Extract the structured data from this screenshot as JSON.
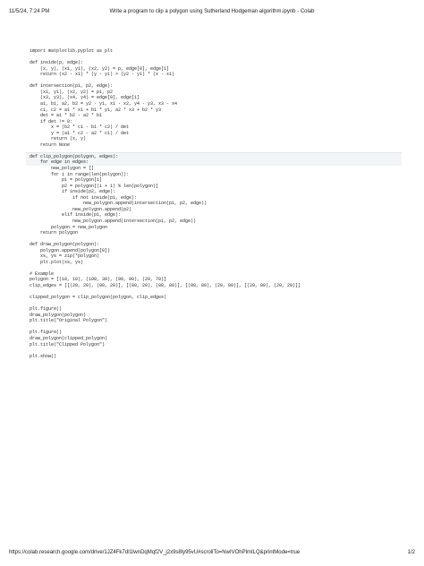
{
  "header": {
    "datetime": "11/5/24, 7:24 PM",
    "title": "Write a program to clip a polygon using Sutherland Hodgeman algorithm.ipynb - Colab"
  },
  "footer": {
    "url": "https://colab.research.google.com/drive/1JZ4Fk7dI1lwnDqMqf2V_j2x9s8ly95vU#scrollTo=NwIVOhPlmILQ&printMode=true",
    "page": "1/2"
  },
  "code": {
    "lines": [
      "import matplotlib.pyplot as plt",
      "",
      "def inside(p, edge):",
      "    (x, y), (x1, y1), (x2, y2) = p, edge[0], edge[1]",
      "    return (x2 - x1) * (y - y1) > (y2 - y1) * (x - x1)",
      "",
      "def intersection(p1, p2, edge):",
      "    (x1, y1), (x2, y2) = p1, p2",
      "    (x3, y3), (x4, y4) = edge[0], edge[1]",
      "    a1, b1, a2, b2 = y2 - y1, x1 - x2, y4 - y3, x3 - x4",
      "    c1, c2 = a1 * x1 + b1 * y1, a2 * x3 + b2 * y3",
      "    det = a1 * b2 - a2 * b1",
      "    if det != 0:",
      "        x = (b2 * c1 - b1 * c2) / det",
      "        y = (a1 * c2 - a2 * c1) / det",
      "        return (x, y)",
      "    return None",
      "",
      "def clip_polygon(polygon, edges):",
      "    for edge in edges:",
      "        new_polygon = []",
      "        for i in range(len(polygon)):",
      "            p1 = polygon[i]",
      "            p2 = polygon[(i + 1) % len(polygon)]",
      "            if inside(p2, edge):",
      "                if not inside(p1, edge):",
      "                    new_polygon.append(intersection(p1, p2, edge))",
      "                new_polygon.append(p2)",
      "            elif inside(p1, edge):",
      "                new_polygon.append(intersection(p1, p2, edge))",
      "        polygon = new_polygon",
      "    return polygon",
      "",
      "def draw_polygon(polygon):",
      "    polygon.append(polygon[0])",
      "    xs, ys = zip(*polygon)",
      "    plt.plot(xs, ys)",
      "",
      "# Example",
      "polygon = [(10, 10), (100, 30), (90, 90), (20, 70)]",
      "clip_edges = [[(20, 20), (80, 20)], [(80, 20), (80, 80)], [(80, 80), (20, 80)], [(20, 80), (20, 20)]]",
      "",
      "clipped_polygon = clip_polygon(polygon, clip_edges)",
      "",
      "plt.figure()",
      "draw_polygon(polygon)",
      "plt.title(\"Original Polygon\")",
      "",
      "plt.figure()",
      "draw_polygon(clipped_polygon)",
      "plt.title(\"Clipped Polygon\")",
      "",
      "plt.show()"
    ]
  }
}
